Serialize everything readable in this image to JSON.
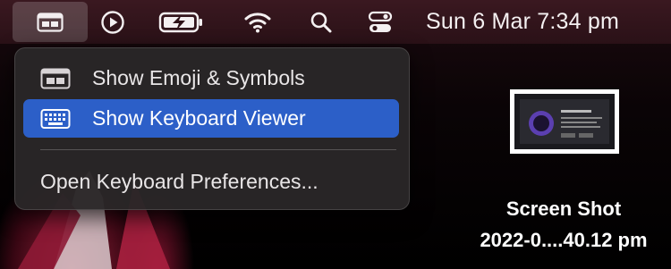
{
  "menubar": {
    "icons": [
      "keyboard-input-menu-icon",
      "play-circle-icon",
      "battery-charging-icon",
      "wifi-icon",
      "search-icon",
      "control-center-icon"
    ],
    "clock": "Sun 6 Mar  7:34 pm"
  },
  "input_menu": {
    "items": [
      {
        "label": "Show Emoji & Symbols",
        "icon": "emoji-symbols-icon"
      },
      {
        "label": "Show Keyboard Viewer",
        "icon": "keyboard-viewer-icon",
        "highlighted": true
      },
      {
        "label": "Open Keyboard Preferences...",
        "icon": null
      }
    ]
  },
  "desktop": {
    "file": {
      "name_line1": "Screen Shot",
      "name_line2": "2022-0....40.12 pm"
    }
  },
  "colors": {
    "menu_highlight": "#2c5fc8",
    "menubar": "#2e1218",
    "menu_bg": "#2a2628"
  }
}
